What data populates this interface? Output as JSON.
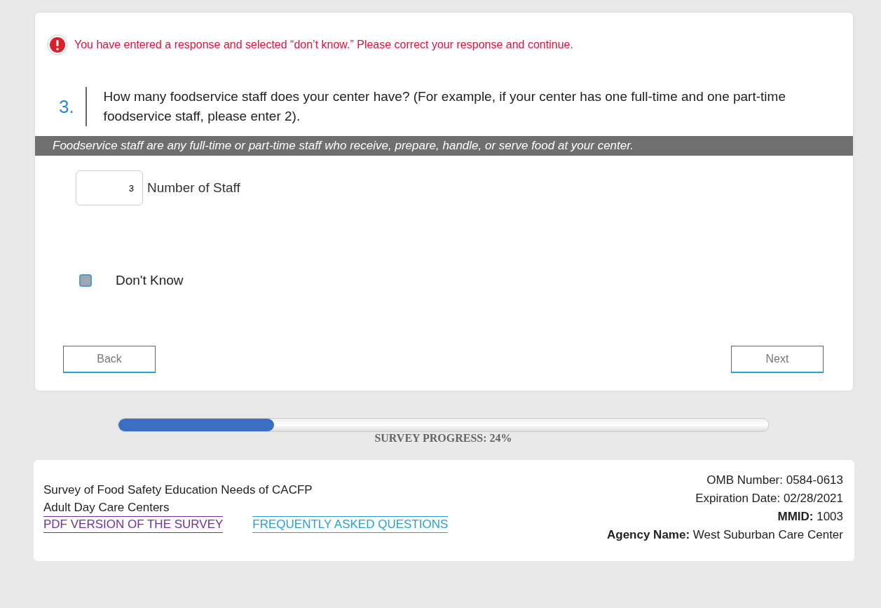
{
  "error": {
    "message": "You have entered a response and selected “don’t know.” Please correct your response and continue."
  },
  "question": {
    "number": "3.",
    "text": "How many foodservice staff does your center have? (For example, if your center has one full-time and one part-time foodservice staff, please enter 2).",
    "note": "Foodservice staff are any full-time or part-time staff who receive, prepare, handle, or serve food at your center."
  },
  "field": {
    "value": "3",
    "label": "Number of Staff"
  },
  "dont_know": {
    "label": "Don't Know",
    "checked": false
  },
  "buttons": {
    "back": "Back",
    "next": "Next"
  },
  "progress": {
    "level": 0.24,
    "label": "SURVEY PROGRESS: 24%"
  },
  "footer": {
    "title_lines": [
      "Survey of Food Safety Education Needs of CACFP",
      "Adult Day Care Centers"
    ],
    "links": [
      {
        "text": "PDF VERSION OF THE SURVEY",
        "color": "#7030a0"
      },
      {
        "text": "FREQUENTLY ASKED QUESTIONS",
        "color": "#2a9fd6"
      }
    ],
    "info": [
      "OMB Number: 0584-0613",
      "Expiration Date: 02/28/2021",
      "**MMID:** 1003",
      "**Agency Name:** West Suburban Care Center"
    ]
  }
}
